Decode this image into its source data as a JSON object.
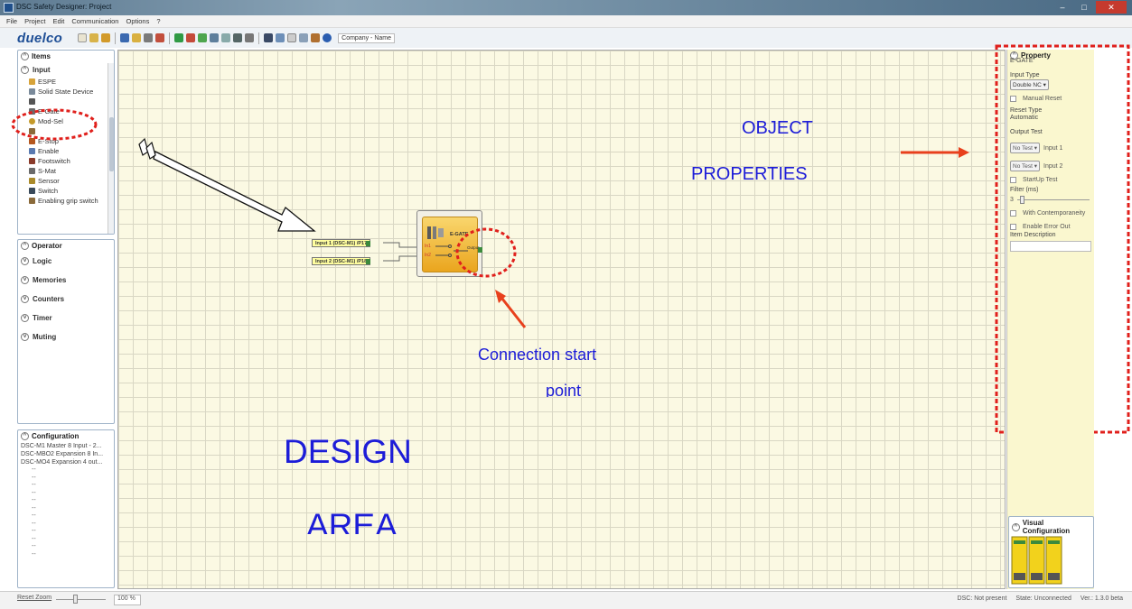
{
  "window": {
    "title": "DSC Safety Designer: Project"
  },
  "menu": [
    "File",
    "Project",
    "Edit",
    "Communication",
    "Options",
    "?"
  ],
  "toolbar": {
    "logo": "duelco",
    "company_field": "Company - Name"
  },
  "items_panel": {
    "header": "Items",
    "section": "Input",
    "items": [
      "ESPE",
      "Solid State Device",
      "",
      "E-Gate",
      "Mod-Sel",
      "",
      "E-Stop",
      "Enable",
      "Footswitch",
      "S-Mat",
      "Sensor",
      "Switch",
      "Enabling grip switch"
    ]
  },
  "operator_panel": {
    "header": "Operator",
    "groups": [
      "Logic",
      "Memories",
      "Counters",
      "Timer",
      "Muting"
    ]
  },
  "config_panel": {
    "header": "Configuration",
    "lines": [
      "DSC-M1 Master 8 Input - 2...",
      "DSC-MBO2 Expansion 8 In...",
      "DSC-MO4 Expansion 4 out..."
    ],
    "placeholders": [
      "--",
      "--",
      "--",
      "--",
      "--",
      "--",
      "--",
      "--",
      "--",
      "--",
      "--",
      "--"
    ]
  },
  "property_panel": {
    "header": "Property",
    "object_name": "E-GATE",
    "input_type_label": "Input Type",
    "input_type_value": "Double NC",
    "manual_reset": "Manual Reset",
    "reset_type_label": "Reset Type",
    "reset_type_value": "Automatic",
    "output_test_label": "Output Test",
    "test1_value": "No Test",
    "test1_label": "Input 1",
    "test2_value": "No Test",
    "test2_label": "Input 2",
    "startup_test": "StartUp Test",
    "filter_label": "Filter (ms)",
    "filter_value": "3",
    "contemporaneity": "With Contemporaneity",
    "error_out": "Enable Error Out",
    "item_description": "Item Description"
  },
  "visual_config": {
    "header": "Visual Configuration"
  },
  "canvas": {
    "input1": "Input 1 (DSC-M1) /P17",
    "input2": "Input 2 (DSC-M1) /P18",
    "block_label": "E-GATE",
    "pin_in1": "In1",
    "pin_in2": "In2",
    "pin_out": "Output"
  },
  "annotations": {
    "object_properties_1": "OBJECT",
    "object_properties_2": "PROPERTIES",
    "connection_1": "Connection start",
    "connection_2": "point",
    "design_1": "DESIGN",
    "design_2": "AREA",
    "annotation_color": "#1c1cd8",
    "marker_color": "#e0201c"
  },
  "statusbar": {
    "reset_zoom": "Reset Zoom",
    "zoom": "100 %",
    "dsc": "DSC: Not present",
    "state": "State: Unconnected",
    "version": "Ver.: 1.3.0 beta"
  }
}
